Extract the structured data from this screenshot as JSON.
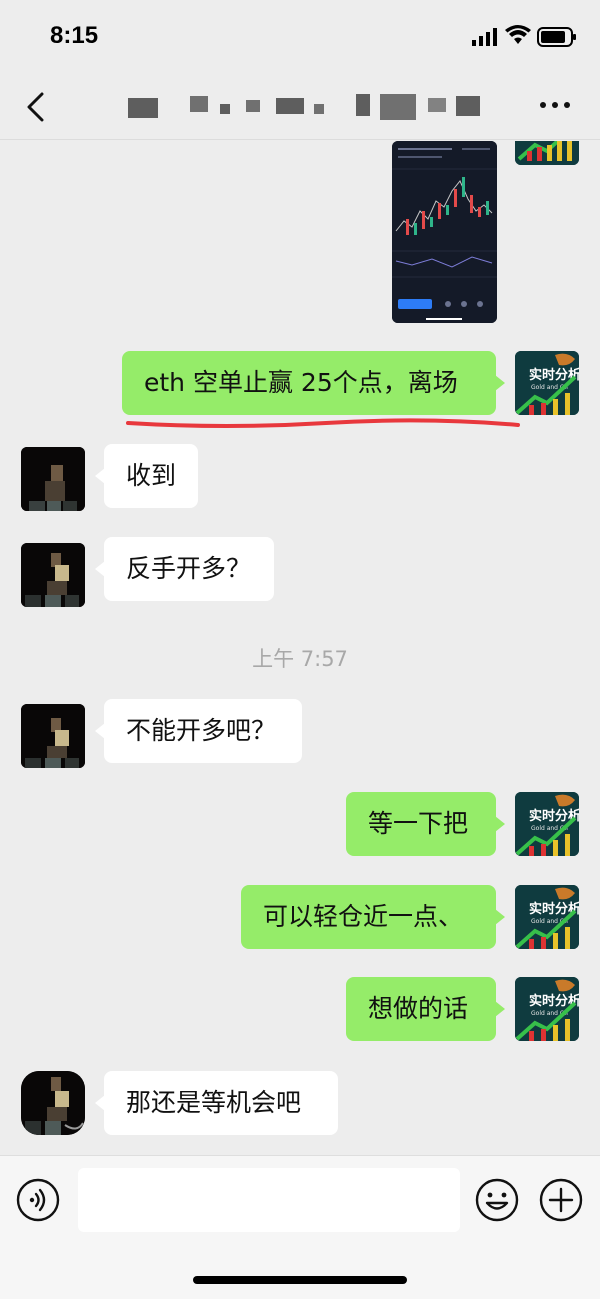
{
  "status_bar": {
    "time": "8:15"
  },
  "chat": {
    "messages": [
      {
        "id": "m1",
        "side": "right",
        "text": "eth 空单止赢 25个点，离场"
      },
      {
        "id": "m2",
        "side": "left",
        "text": "收到"
      },
      {
        "id": "m3",
        "side": "left",
        "text": "反手开多？"
      },
      {
        "id": "m4",
        "side": "left",
        "text": "不能开多吧？"
      },
      {
        "id": "m5",
        "side": "right",
        "text": "等一下把"
      },
      {
        "id": "m6",
        "side": "right",
        "text": "可以轻仓近一点、"
      },
      {
        "id": "m7",
        "side": "right",
        "text": "想做的话"
      },
      {
        "id": "m8",
        "side": "left",
        "text": "那还是等机会吧"
      }
    ],
    "timestamp": "上午 7:57",
    "self_avatar": {
      "text": "实时分析",
      "subtext": "Gold and Oil"
    }
  },
  "colors": {
    "self_bubble": "#95ec69",
    "other_bubble": "#ffffff",
    "background": "#ededed",
    "underline": "#e8383d"
  },
  "icons": [
    "back-icon",
    "more-icon",
    "voice-icon",
    "emoji-icon",
    "add-icon"
  ]
}
